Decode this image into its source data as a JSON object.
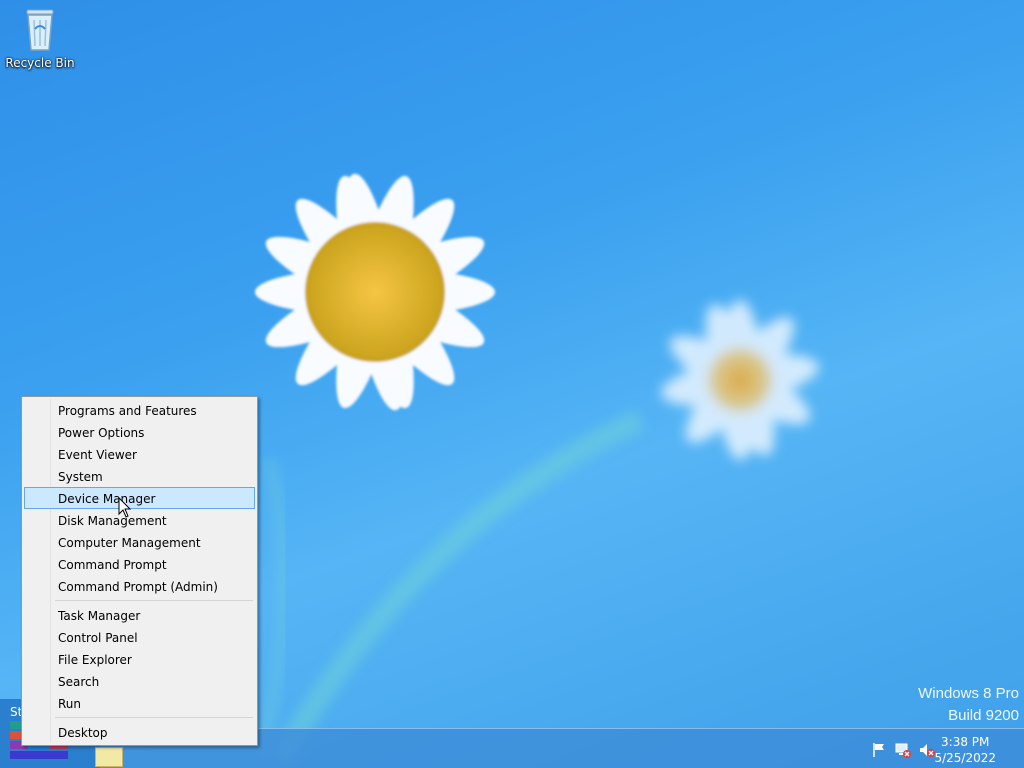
{
  "desktop": {
    "icons": [
      {
        "label": "Recycle Bin",
        "icon": "recycle-bin-icon"
      }
    ]
  },
  "watermark": {
    "line1": "Windows 8 Pro",
    "line2": "Build 9200"
  },
  "context_menu": {
    "selected_index": 4,
    "groups": [
      [
        "Programs and Features",
        "Power Options",
        "Event Viewer",
        "System",
        "Device Manager",
        "Disk Management",
        "Computer Management",
        "Command Prompt",
        "Command Prompt (Admin)"
      ],
      [
        "Task Manager",
        "Control Panel",
        "File Explorer",
        "Search",
        "Run"
      ],
      [
        "Desktop"
      ]
    ]
  },
  "taskbar": {
    "start_label": "St",
    "tray_icons": [
      "action-center-flag-icon",
      "network-disconnected-icon",
      "volume-muted-icon"
    ],
    "clock": {
      "time": "3:38 PM",
      "date": "5/25/2022"
    }
  },
  "colors": {
    "accent": "#2a7fcf",
    "menu_selected_bg": "#cce8ff",
    "menu_selected_border": "#66a7e8"
  }
}
